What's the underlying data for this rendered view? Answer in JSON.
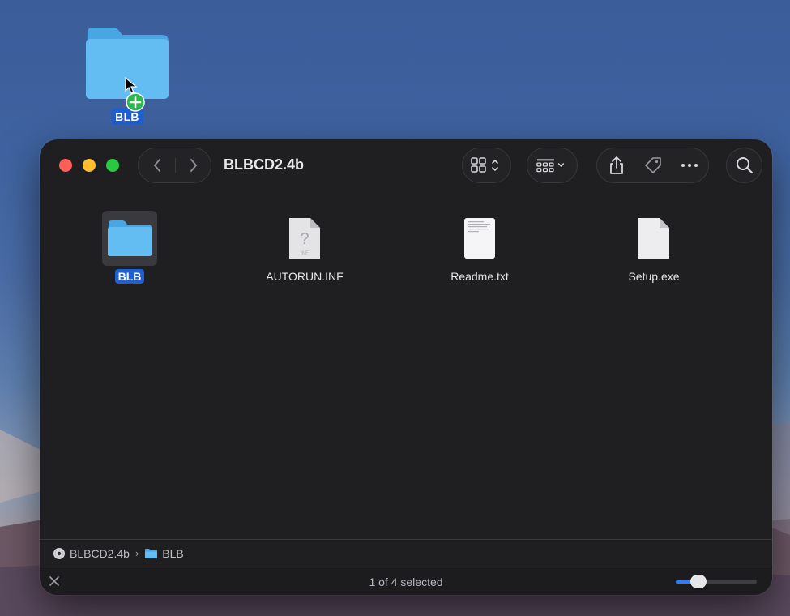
{
  "desktop": {
    "folder_label": "BLB"
  },
  "window": {
    "title": "BLBCD2.4b"
  },
  "files": [
    {
      "name": "BLB",
      "kind": "folder",
      "selected": true
    },
    {
      "name": "AUTORUN.INF",
      "kind": "unknown-document",
      "selected": false,
      "icon_text": "INF"
    },
    {
      "name": "Readme.txt",
      "kind": "text-document",
      "selected": false
    },
    {
      "name": "Setup.exe",
      "kind": "blank-document",
      "selected": false
    }
  ],
  "pathbar": {
    "items": [
      {
        "label": "BLBCD2.4b",
        "icon": "disc-icon"
      },
      {
        "label": "BLB",
        "icon": "folder-icon"
      }
    ]
  },
  "status": {
    "text": "1 of 4 selected",
    "icon_size_slider": 0.22
  },
  "colors": {
    "accent": "#1f5fd1",
    "folder": "#5cb8f0",
    "window_bg": "#1f1f22"
  }
}
